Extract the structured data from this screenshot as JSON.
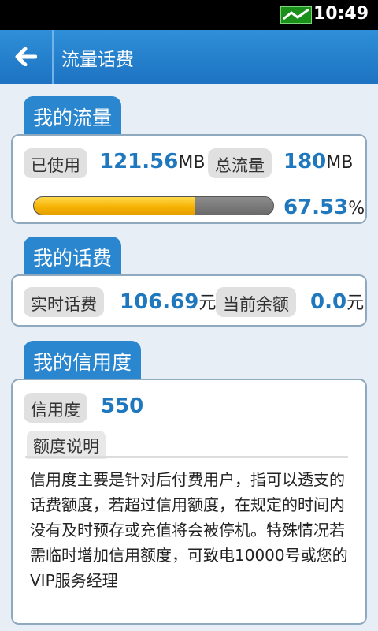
{
  "status_bar": {
    "time": "10:49",
    "signal_icon": "signal-icon"
  },
  "header": {
    "title": "流量话费",
    "back_icon": "back-arrow-icon"
  },
  "traffic": {
    "section_title": "我的流量",
    "used_label": "已使用",
    "used_value": "121.56",
    "used_unit": "MB",
    "total_label": "总流量",
    "total_value": "180",
    "total_unit": "MB",
    "progress_percent": 67.53,
    "progress_text": "67.53",
    "progress_unit": "%"
  },
  "billing": {
    "section_title": "我的话费",
    "realtime_label": "实时话费",
    "realtime_value": "106.69",
    "realtime_unit": "元",
    "balance_label": "当前余额",
    "balance_value": "0.0",
    "balance_unit": "元"
  },
  "credit": {
    "section_title": "我的信用度",
    "credit_label": "信用度",
    "credit_value": "550",
    "desc_label": "额度说明",
    "desc_text": "信用度主要是针对后付费用户，指可以透支的话费额度，若超过信用额度，在规定的时间内没有及时预存或充值将会被停机。特殊情况若需临时增加信用额度，可致电10000号或您的VIP服务经理"
  },
  "colors": {
    "accent": "#2a86cf",
    "value": "#1f77bd",
    "progress": "#f5b000"
  }
}
